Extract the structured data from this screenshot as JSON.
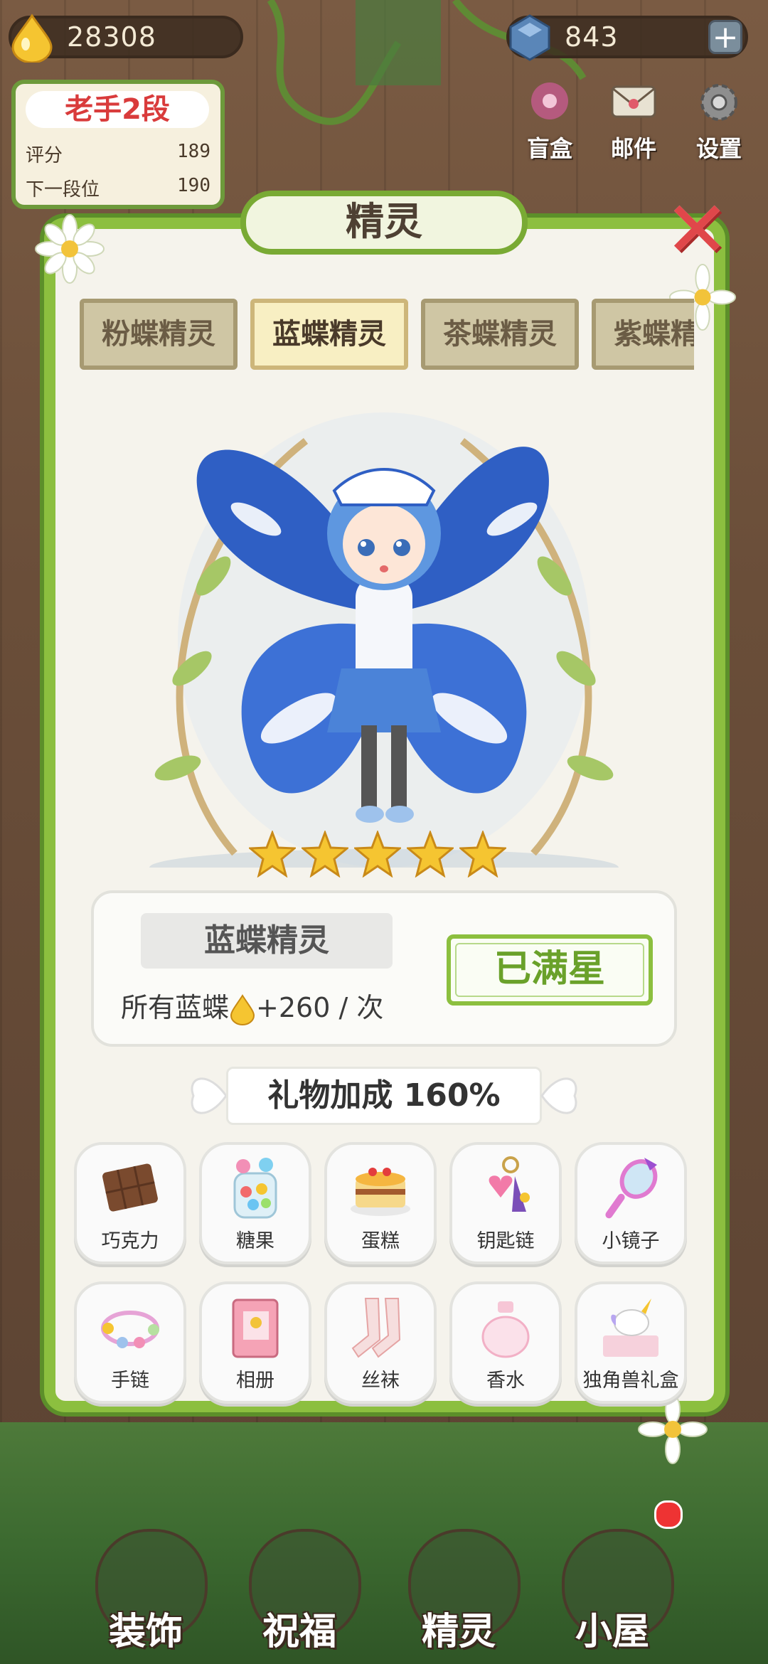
{
  "hud": {
    "gold_amount": "28308",
    "gem_amount": "843",
    "rank": {
      "title": "老手2段",
      "score_label": "评分",
      "score_value": "189",
      "next_label": "下一段位",
      "next_value": "190"
    },
    "top_nav": [
      {
        "label": "盲盒",
        "icon": "gift-box-icon"
      },
      {
        "label": "邮件",
        "icon": "mail-icon"
      },
      {
        "label": "设置",
        "icon": "gear-icon"
      }
    ]
  },
  "panel": {
    "title": "精灵",
    "tabs": [
      {
        "label": "粉蝶精灵",
        "active": false
      },
      {
        "label": "蓝蝶精灵",
        "active": true
      },
      {
        "label": "茶蝶精灵",
        "active": false
      },
      {
        "label": "紫蝶精灵",
        "active": false
      }
    ],
    "stars": 5,
    "sprite": {
      "name": "蓝蝶精灵",
      "bonus_prefix": "所有蓝蝶",
      "bonus_suffix": "+260 / 次",
      "status_button": "已满星"
    },
    "gift_bonus": "礼物加成 160%",
    "gifts": [
      {
        "label": "巧克力",
        "icon": "chocolate-icon"
      },
      {
        "label": "糖果",
        "icon": "candy-jar-icon"
      },
      {
        "label": "蛋糕",
        "icon": "cake-icon"
      },
      {
        "label": "钥匙链",
        "icon": "keychain-icon"
      },
      {
        "label": "小镜子",
        "icon": "mirror-icon"
      },
      {
        "label": "手链",
        "icon": "bracelet-icon"
      },
      {
        "label": "相册",
        "icon": "photo-album-icon"
      },
      {
        "label": "丝袜",
        "icon": "stockings-icon"
      },
      {
        "label": "香水",
        "icon": "perfume-icon"
      },
      {
        "label": "独角兽礼盒",
        "icon": "unicorn-giftbox-icon"
      }
    ]
  },
  "bottom_nav": [
    {
      "label": "装饰",
      "icon": "plant-icon"
    },
    {
      "label": "祝福",
      "icon": "blessing-icon"
    },
    {
      "label": "精灵",
      "icon": "fairy-icon"
    },
    {
      "label": "小屋",
      "icon": "house-icon"
    }
  ],
  "colors": {
    "vine_green": "#8cbf3f",
    "close_red": "#e0474a",
    "star_gold": "#f5c531",
    "butterfly_blue": "#2f5fc4"
  }
}
